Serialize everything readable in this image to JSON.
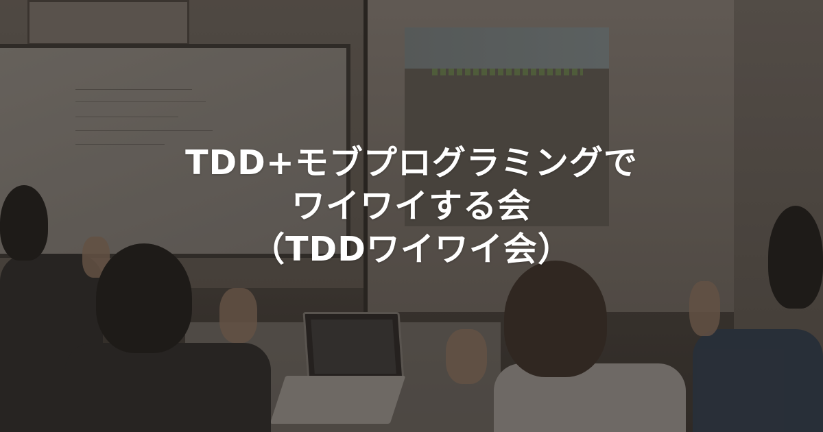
{
  "title_lines": [
    "TDD+モブプログラミングで",
    "ワイワイする会",
    "（TDDワイワイ会）"
  ],
  "overlay_color": "#1e1a17"
}
